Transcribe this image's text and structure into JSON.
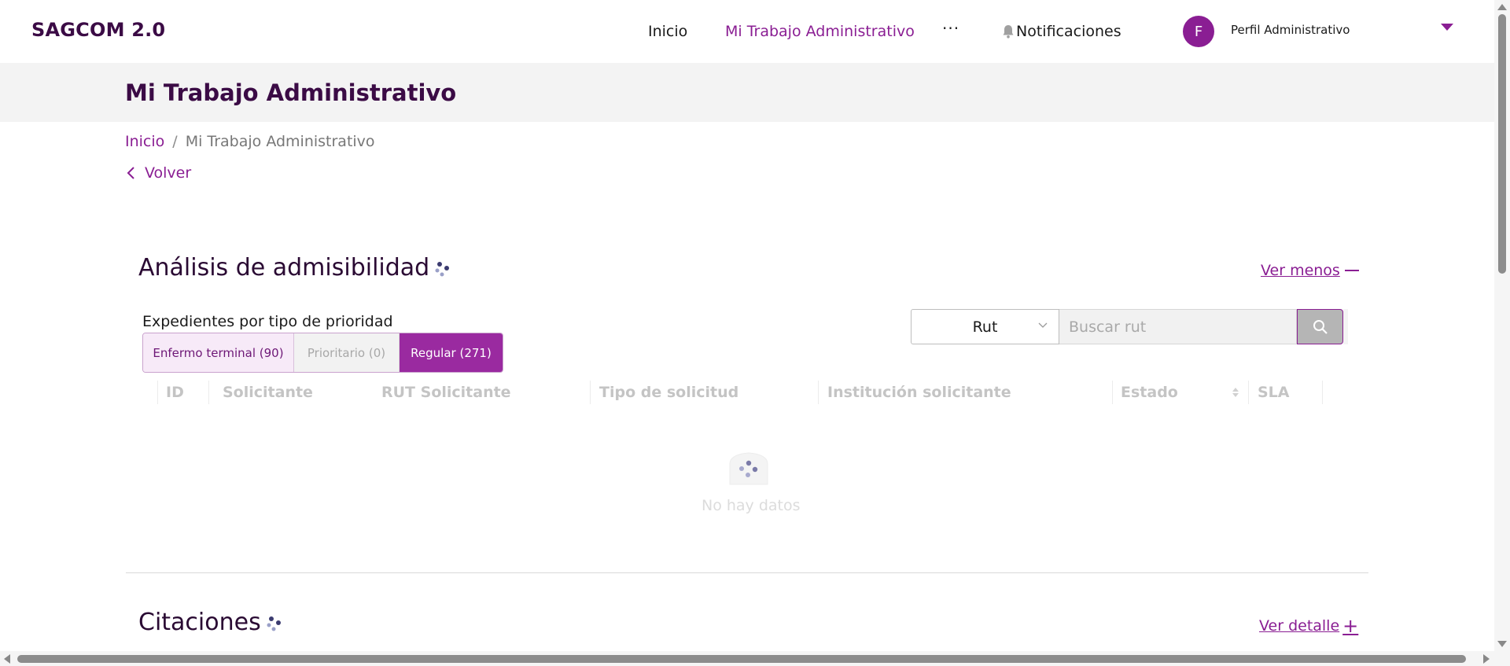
{
  "app": {
    "title": "SAGCOM 2.0"
  },
  "nav": {
    "home": "Inicio",
    "work": "Mi Trabajo Administrativo",
    "more": "···",
    "notifications": "Notificaciones"
  },
  "profile": {
    "initial": "F",
    "name": "Perfil Administrativo"
  },
  "page": {
    "title": "Mi Trabajo Administrativo"
  },
  "breadcrumb": {
    "home": "Inicio",
    "separator": "/",
    "current": "Mi Trabajo Administrativo"
  },
  "back": {
    "label": "Volver"
  },
  "admissibility": {
    "title": "Análisis de admisibilidad",
    "toggle_label": "Ver menos",
    "priority_label": "Expedientes por tipo de prioridad",
    "segments": [
      {
        "label": "Enfermo terminal (90)"
      },
      {
        "label": "Prioritario (0)"
      },
      {
        "label": "Regular (271)",
        "selected": true
      }
    ],
    "search": {
      "field_select": "Rut",
      "placeholder": "Buscar rut"
    },
    "table": {
      "columns": [
        "ID",
        "Solicitante",
        "RUT Solicitante",
        "Tipo de solicitud",
        "Institución solicitante",
        "Estado",
        "SLA"
      ],
      "empty_text": "No hay datos"
    }
  },
  "citations": {
    "title": "Citaciones",
    "toggle_label": "Ver detalle"
  },
  "colors": {
    "accent": "#8a1e93",
    "title": "#3b0b45",
    "band": "#f3f3f3"
  },
  "icons": [
    "bell-icon",
    "chevron-left-icon",
    "chevron-down-icon",
    "search-icon",
    "loading-dots-icon",
    "empty-box-icon",
    "sort-icon",
    "minus-icon",
    "plus-icon"
  ]
}
